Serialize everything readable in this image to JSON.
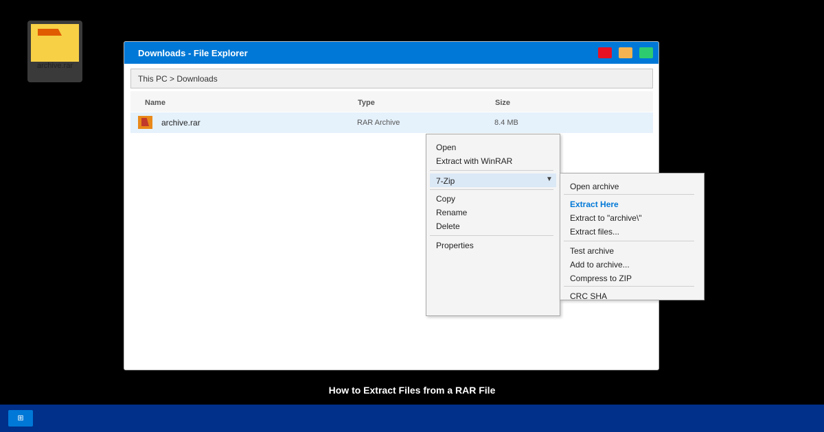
{
  "desktop": {
    "icon_label": "archive.rar"
  },
  "window": {
    "title": "Downloads - File Explorer",
    "address": "This PC > Downloads",
    "columns": {
      "name": "Name",
      "type": "Type",
      "size": "Size"
    },
    "files": [
      {
        "name": "archive.rar",
        "type": "RAR Archive",
        "size": "8.4 MB",
        "icon": "rar-file-icon"
      }
    ]
  },
  "context_menu": {
    "items": [
      "Open",
      "Extract with WinRAR",
      "7-Zip",
      "Copy",
      "Rename",
      "Delete",
      "Properties"
    ],
    "submenu_arrow": "▼"
  },
  "submenu_7zip": {
    "items": [
      "Open archive",
      "Extract Here",
      "Extract to \"archive\\\"",
      "Extract files...",
      "Test archive",
      "Add to archive...",
      "Compress to ZIP",
      "CRC SHA"
    ]
  },
  "caption": "How to Extract Files from a RAR File",
  "taskbar": {
    "start_glyph": "⊞"
  },
  "colors": {
    "titlebar": "#0078d7",
    "taskbar": "#00308a",
    "highlight": "#0078d7",
    "close": "#e81123",
    "minimize": "#f4b350",
    "maximize": "#2ecc71"
  }
}
